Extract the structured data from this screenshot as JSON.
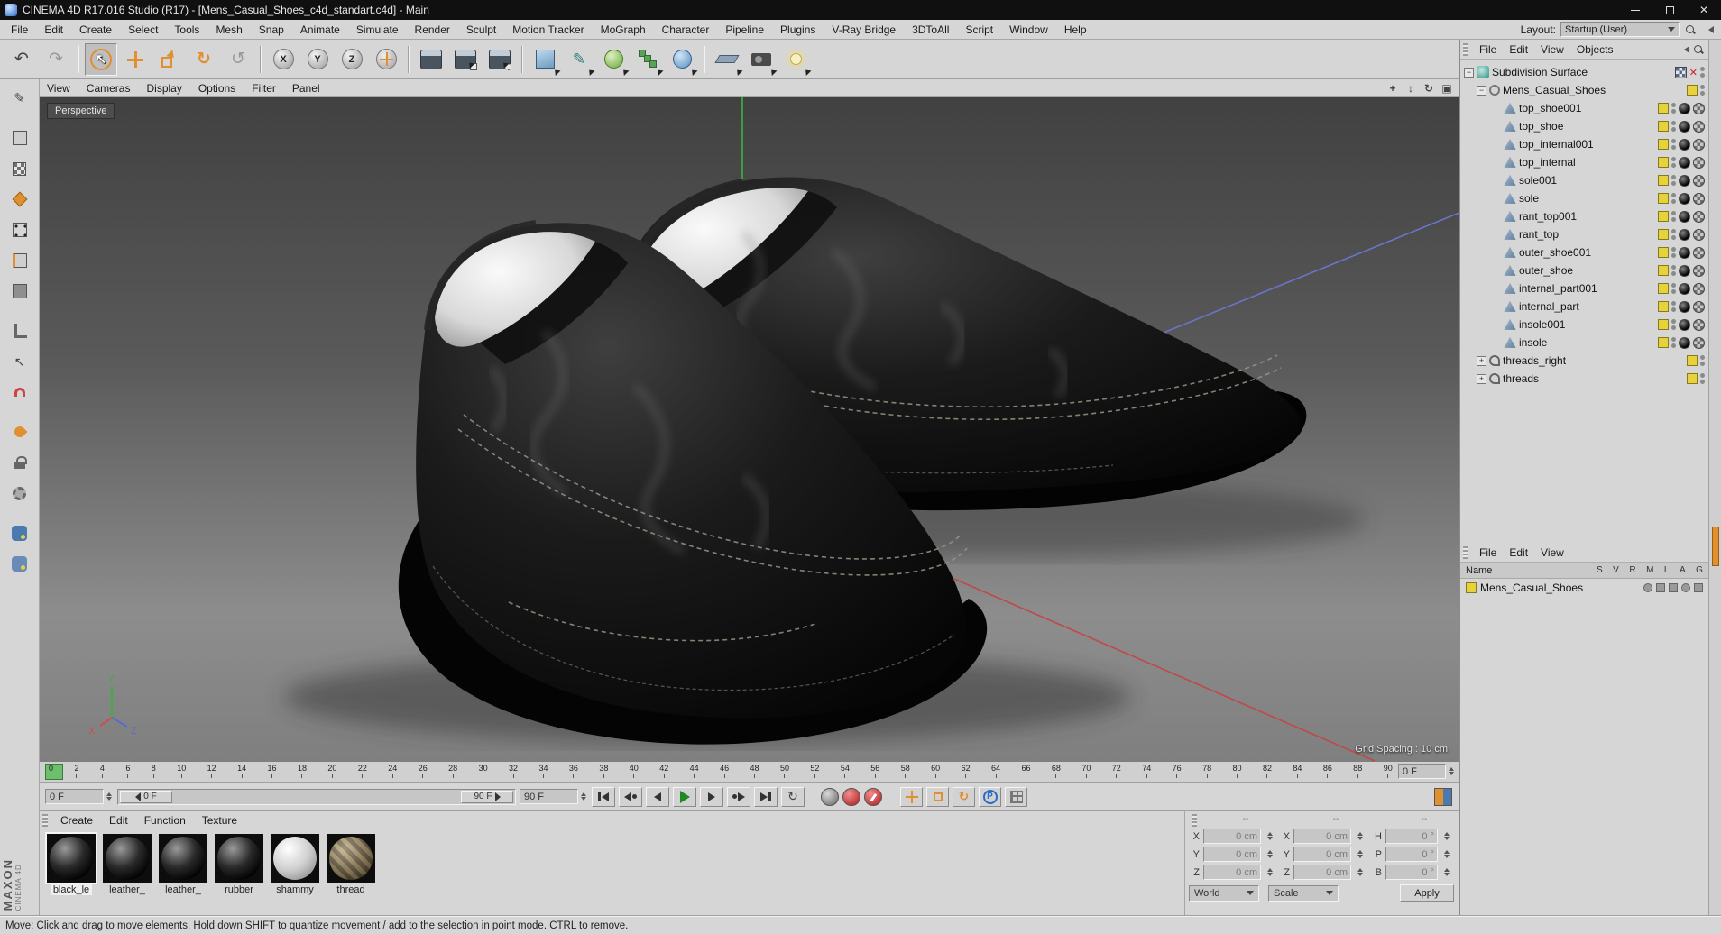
{
  "window": {
    "title": "CINEMA 4D R17.016 Studio (R17) - [Mens_Casual_Shoes_c4d_standart.c4d] - Main"
  },
  "menubar": {
    "items": [
      "File",
      "Edit",
      "Create",
      "Select",
      "Tools",
      "Mesh",
      "Snap",
      "Animate",
      "Simulate",
      "Render",
      "Sculpt",
      "Motion Tracker",
      "MoGraph",
      "Character",
      "Pipeline",
      "Plugins",
      "V-Ray Bridge",
      "3DToAll",
      "Script",
      "Window",
      "Help"
    ]
  },
  "layout": {
    "label": "Layout:",
    "value": "Startup (User)"
  },
  "toolbar": {
    "axis_locks": [
      "X",
      "Y",
      "Z"
    ]
  },
  "viewport": {
    "menus": [
      "View",
      "Cameras",
      "Display",
      "Options",
      "Filter",
      "Panel"
    ],
    "camera_label": "Perspective",
    "grid_spacing": "Grid Spacing : 10 cm",
    "axis": {
      "x": "X",
      "y": "Y",
      "z": "Z"
    }
  },
  "object_manager": {
    "menus": [
      "File",
      "Edit",
      "View",
      "Objects"
    ],
    "rows": [
      {
        "label": "Subdivision Surface",
        "kind": "sds",
        "lvl": "lvl0",
        "exp": "minus"
      },
      {
        "label": "Mens_Casual_Shoes",
        "kind": "group",
        "lvl": "lvl1",
        "exp": "minus"
      },
      {
        "label": "top_shoe001",
        "kind": "mesh",
        "lvl": "lvl2",
        "exp": ""
      },
      {
        "label": "top_shoe",
        "kind": "mesh",
        "lvl": "lvl2",
        "exp": ""
      },
      {
        "label": "top_internal001",
        "kind": "mesh",
        "lvl": "lvl2",
        "exp": ""
      },
      {
        "label": "top_internal",
        "kind": "mesh",
        "lvl": "lvl2",
        "exp": ""
      },
      {
        "label": "sole001",
        "kind": "mesh",
        "lvl": "lvl2",
        "exp": ""
      },
      {
        "label": "sole",
        "kind": "mesh",
        "lvl": "lvl2",
        "exp": ""
      },
      {
        "label": "rant_top001",
        "kind": "mesh",
        "lvl": "lvl2",
        "exp": ""
      },
      {
        "label": "rant_top",
        "kind": "mesh",
        "lvl": "lvl2",
        "exp": ""
      },
      {
        "label": "outer_shoe001",
        "kind": "mesh",
        "lvl": "lvl2",
        "exp": ""
      },
      {
        "label": "outer_shoe",
        "kind": "mesh",
        "lvl": "lvl2",
        "exp": ""
      },
      {
        "label": "internal_part001",
        "kind": "mesh",
        "lvl": "lvl2",
        "exp": ""
      },
      {
        "label": "internal_part",
        "kind": "mesh",
        "lvl": "lvl2",
        "exp": ""
      },
      {
        "label": "insole001",
        "kind": "mesh",
        "lvl": "lvl2",
        "exp": ""
      },
      {
        "label": "insole",
        "kind": "mesh",
        "lvl": "lvl2",
        "exp": ""
      },
      {
        "label": "threads_right",
        "kind": "spline",
        "lvl": "lvl1",
        "exp": "plus"
      },
      {
        "label": "threads",
        "kind": "spline",
        "lvl": "lvl1",
        "exp": "plus"
      }
    ]
  },
  "layer_panel": {
    "menus": [
      "File",
      "Edit",
      "View"
    ],
    "name_header": "Name",
    "columns": [
      "S",
      "V",
      "R",
      "M",
      "L",
      "A",
      "G"
    ],
    "item_label": "Mens_Casual_Shoes"
  },
  "timeline": {
    "ticks": [
      0,
      2,
      4,
      6,
      8,
      10,
      12,
      14,
      16,
      18,
      20,
      22,
      24,
      26,
      28,
      30,
      32,
      34,
      36,
      38,
      40,
      42,
      44,
      46,
      48,
      50,
      52,
      54,
      56,
      58,
      60,
      62,
      64,
      66,
      68,
      70,
      72,
      74,
      76,
      78,
      80,
      82,
      84,
      86,
      88,
      90
    ],
    "current_frame": "0 F",
    "slider_start": "0 F",
    "slider_end": "90 F",
    "end_frame": "90 F"
  },
  "transport": {
    "parameter_key_label": "P"
  },
  "materials": {
    "menus": [
      "Create",
      "Edit",
      "Function",
      "Texture"
    ],
    "items": [
      {
        "name": "black_le",
        "swatch": "dark",
        "sel": "selected"
      },
      {
        "name": "leather_",
        "swatch": "dark",
        "sel": ""
      },
      {
        "name": "leather_",
        "swatch": "dark",
        "sel": ""
      },
      {
        "name": "rubber",
        "swatch": "dark",
        "sel": ""
      },
      {
        "name": "shammy",
        "swatch": "light",
        "sel": ""
      },
      {
        "name": "thread",
        "swatch": "thread",
        "sel": ""
      }
    ]
  },
  "coordinates": {
    "headers": [
      "--",
      "--",
      "--"
    ],
    "pos_rows": [
      {
        "label": "X",
        "value": "0 cm"
      },
      {
        "label": "Y",
        "value": "0 cm"
      },
      {
        "label": "Z",
        "value": "0 cm"
      }
    ],
    "size_rows": [
      {
        "label": "X",
        "value": "0 cm"
      },
      {
        "label": "Y",
        "value": "0 cm"
      },
      {
        "label": "Z",
        "value": "0 cm"
      }
    ],
    "rot_rows": [
      {
        "label": "H",
        "value": "0 °"
      },
      {
        "label": "P",
        "value": "0 °"
      },
      {
        "label": "B",
        "value": "0 °"
      }
    ],
    "world": "World",
    "scale": "Scale",
    "apply": "Apply"
  },
  "statusbar": {
    "text": "Move: Click and drag to move elements. Hold down SHIFT to quantize movement / add to the selection in point mode. CTRL to remove."
  },
  "brand": {
    "line1": "MAXON",
    "line2": "CINEMA 4D"
  }
}
